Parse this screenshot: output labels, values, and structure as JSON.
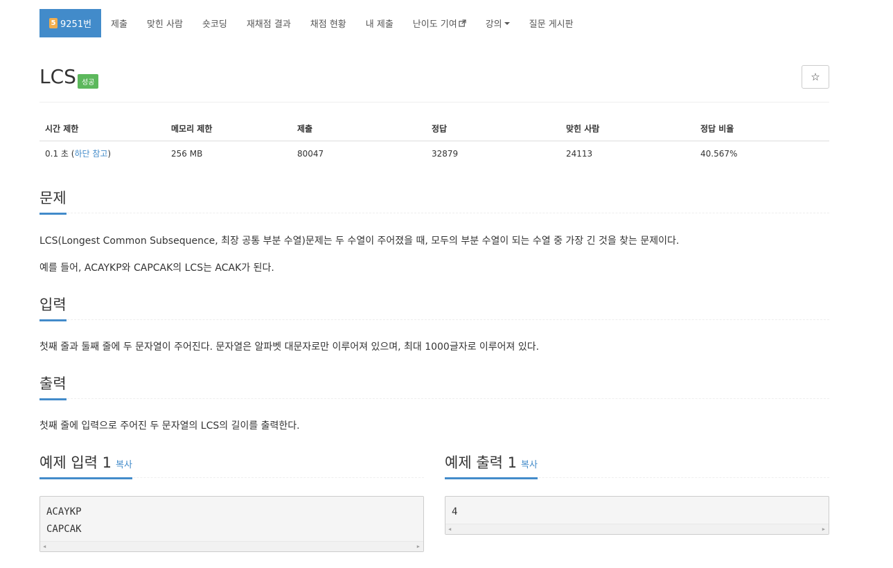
{
  "nav": {
    "problem_number": "9251번",
    "problem_badge": "5",
    "items": [
      "제출",
      "맞힌 사람",
      "숏코딩",
      "재채점 결과",
      "채점 현황",
      "내 제출",
      "난이도 기여",
      "강의",
      "질문 게시판"
    ]
  },
  "title": {
    "text": "LCS",
    "status": "성공",
    "star": "☆"
  },
  "info_table": {
    "headers": [
      "시간 제한",
      "메모리 제한",
      "제출",
      "정답",
      "맞힌 사람",
      "정답 비율"
    ],
    "time_limit": "0.1 초 (",
    "time_link": "하단 참고",
    "time_suffix": ")",
    "memory": "256 MB",
    "submissions": "80047",
    "accepted": "32879",
    "solvers": "24113",
    "ratio": "40.567%"
  },
  "problem": {
    "heading": "문제",
    "paragraphs": [
      "LCS(Longest Common Subsequence, 최장 공통 부분 수열)문제는 두 수열이 주어졌을 때, 모두의 부분 수열이 되는 수열 중 가장 긴 것을 찾는 문제이다.",
      "예를 들어, ACAYKP와 CAPCAK의 LCS는 ACAK가 된다."
    ]
  },
  "input": {
    "heading": "입력",
    "text": "첫째 줄과 둘째 줄에 두 문자열이 주어진다. 문자열은 알파벳 대문자로만 이루어져 있으며, 최대 1000글자로 이루어져 있다."
  },
  "output": {
    "heading": "출력",
    "text": "첫째 줄에 입력으로 주어진 두 문자열의 LCS의 길이를 출력한다."
  },
  "sample_input": {
    "heading": "예제 입력 1",
    "copy": "복사",
    "lines": [
      "ACAYKP",
      "CAPCAK"
    ]
  },
  "sample_output": {
    "heading": "예제 출력 1",
    "copy": "복사",
    "lines": [
      "4"
    ]
  },
  "colors": {
    "accent": "#428bca",
    "success": "#5cb85c",
    "badge": "#f0ad4e"
  }
}
